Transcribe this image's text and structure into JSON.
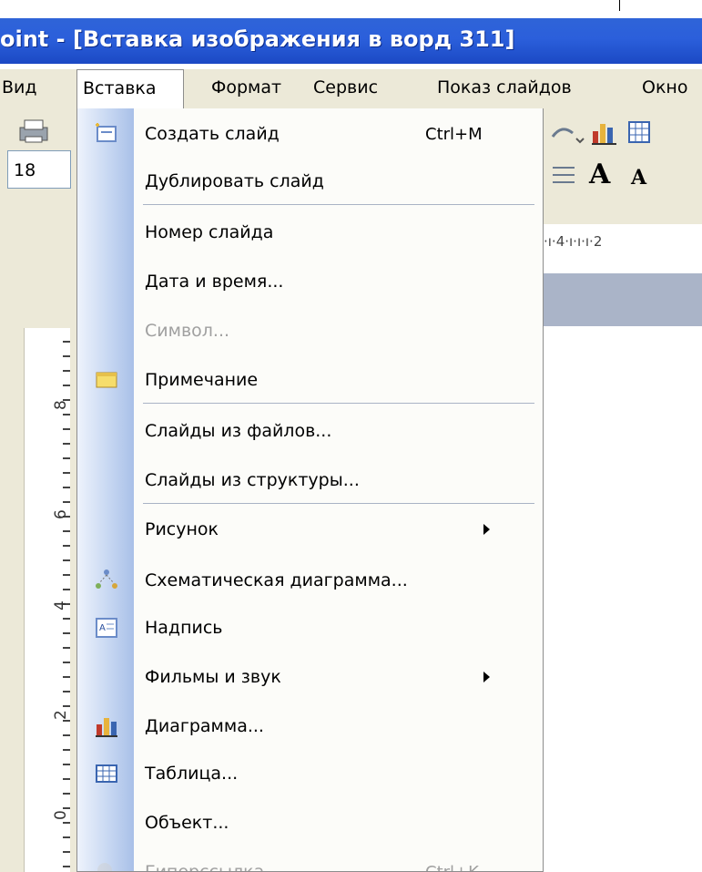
{
  "window": {
    "title": "oint - [Вставка изображения в ворд 311]"
  },
  "menubar": {
    "items": [
      {
        "label": "Вид"
      },
      {
        "label": "Вставка"
      },
      {
        "label": "Формат"
      },
      {
        "label": "Сервис"
      },
      {
        "label": "Показ слайдов"
      },
      {
        "label": "Окно"
      }
    ],
    "active_index": 1
  },
  "toolbar": {
    "font_size": "18"
  },
  "ruler": {
    "horizontal_text": "·ı·4·ı·ı·ı·2",
    "vertical_numbers": [
      "8",
      "6",
      "4",
      "2",
      "0"
    ]
  },
  "insert_menu": {
    "items": [
      {
        "label": "Создать слайд",
        "shortcut": "Ctrl+M",
        "icon": "new-slide-icon",
        "enabled": true
      },
      {
        "label": "Дублировать слайд",
        "icon": "",
        "enabled": true
      },
      {
        "label": "Номер слайда",
        "icon": "",
        "enabled": true
      },
      {
        "label": "Дата и время...",
        "icon": "",
        "enabled": true
      },
      {
        "label": "Символ...",
        "icon": "",
        "enabled": false
      },
      {
        "label": "Примечание",
        "icon": "comment-icon",
        "enabled": true
      },
      {
        "label": "Слайды из файлов...",
        "icon": "",
        "enabled": true
      },
      {
        "label": "Слайды из структуры...",
        "icon": "",
        "enabled": true
      },
      {
        "label": "Рисунок",
        "icon": "",
        "enabled": true,
        "submenu": true
      },
      {
        "label": "Схематическая диаграмма...",
        "icon": "diagram-icon",
        "enabled": true
      },
      {
        "label": "Надпись",
        "icon": "textbox-icon",
        "enabled": true
      },
      {
        "label": "Фильмы и звук",
        "icon": "",
        "enabled": true,
        "submenu": true
      },
      {
        "label": "Диаграмма...",
        "icon": "chart-icon",
        "enabled": true
      },
      {
        "label": "Таблица...",
        "icon": "table-icon",
        "enabled": true
      },
      {
        "label": "Объект...",
        "icon": "",
        "enabled": true
      },
      {
        "label": "Гиперссылка...",
        "shortcut": "Ctrl+K",
        "icon": "hyperlink-icon",
        "enabled": false
      }
    ]
  },
  "colors": {
    "title_bar": "#2b5fdb",
    "menu_bg": "#ece9d8",
    "gutter": "#c4d5f1",
    "disabled_text": "#a0a0a0"
  }
}
